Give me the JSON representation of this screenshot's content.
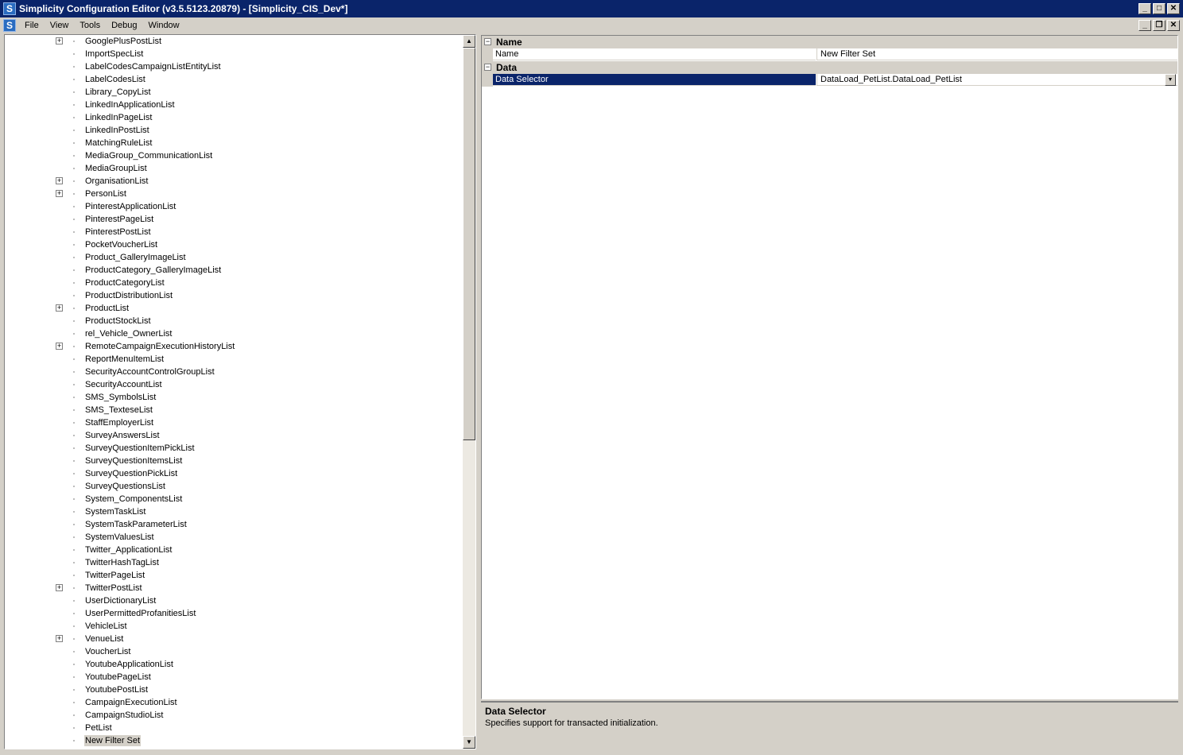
{
  "window": {
    "title": "Simplicity Configuration Editor (v3.5.5123.20879) - [Simplicity_CIS_Dev*]",
    "app_icon": "S",
    "controls": {
      "minimize": "_",
      "maximize": "□",
      "close": "✕"
    }
  },
  "menu": {
    "icon": "S",
    "items": [
      "File",
      "View",
      "Tools",
      "Debug",
      "Window"
    ],
    "mdi_controls": {
      "minimize": "_",
      "restore": "❐",
      "close": "✕"
    }
  },
  "tree": {
    "items": [
      {
        "label": "GooglePlusPostList",
        "expandable": true
      },
      {
        "label": "ImportSpecList",
        "expandable": false
      },
      {
        "label": "LabelCodesCampaignListEntityList",
        "expandable": false
      },
      {
        "label": "LabelCodesList",
        "expandable": false
      },
      {
        "label": "Library_CopyList",
        "expandable": false
      },
      {
        "label": "LinkedInApplicationList",
        "expandable": false
      },
      {
        "label": "LinkedInPageList",
        "expandable": false
      },
      {
        "label": "LinkedInPostList",
        "expandable": false
      },
      {
        "label": "MatchingRuleList",
        "expandable": false
      },
      {
        "label": "MediaGroup_CommunicationList",
        "expandable": false
      },
      {
        "label": "MediaGroupList",
        "expandable": false
      },
      {
        "label": "OrganisationList",
        "expandable": true
      },
      {
        "label": "PersonList",
        "expandable": true
      },
      {
        "label": "PinterestApplicationList",
        "expandable": false
      },
      {
        "label": "PinterestPageList",
        "expandable": false
      },
      {
        "label": "PinterestPostList",
        "expandable": false
      },
      {
        "label": "PocketVoucherList",
        "expandable": false
      },
      {
        "label": "Product_GalleryImageList",
        "expandable": false
      },
      {
        "label": "ProductCategory_GalleryImageList",
        "expandable": false
      },
      {
        "label": "ProductCategoryList",
        "expandable": false
      },
      {
        "label": "ProductDistributionList",
        "expandable": false
      },
      {
        "label": "ProductList",
        "expandable": true
      },
      {
        "label": "ProductStockList",
        "expandable": false
      },
      {
        "label": "rel_Vehicle_OwnerList",
        "expandable": false
      },
      {
        "label": "RemoteCampaignExecutionHistoryList",
        "expandable": true
      },
      {
        "label": "ReportMenuItemList",
        "expandable": false
      },
      {
        "label": "SecurityAccountControlGroupList",
        "expandable": false
      },
      {
        "label": "SecurityAccountList",
        "expandable": false
      },
      {
        "label": "SMS_SymbolsList",
        "expandable": false
      },
      {
        "label": "SMS_TexteseList",
        "expandable": false
      },
      {
        "label": "StaffEmployerList",
        "expandable": false
      },
      {
        "label": "SurveyAnswersList",
        "expandable": false
      },
      {
        "label": "SurveyQuestionItemPickList",
        "expandable": false
      },
      {
        "label": "SurveyQuestionItemsList",
        "expandable": false
      },
      {
        "label": "SurveyQuestionPickList",
        "expandable": false
      },
      {
        "label": "SurveyQuestionsList",
        "expandable": false
      },
      {
        "label": "System_ComponentsList",
        "expandable": false
      },
      {
        "label": "SystemTaskList",
        "expandable": false
      },
      {
        "label": "SystemTaskParameterList",
        "expandable": false
      },
      {
        "label": "SystemValuesList",
        "expandable": false
      },
      {
        "label": "Twitter_ApplicationList",
        "expandable": false
      },
      {
        "label": "TwitterHashTagList",
        "expandable": false
      },
      {
        "label": "TwitterPageList",
        "expandable": false
      },
      {
        "label": "TwitterPostList",
        "expandable": true
      },
      {
        "label": "UserDictionaryList",
        "expandable": false
      },
      {
        "label": "UserPermittedProfanitiesList",
        "expandable": false
      },
      {
        "label": "VehicleList",
        "expandable": false
      },
      {
        "label": "VenueList",
        "expandable": true
      },
      {
        "label": "VoucherList",
        "expandable": false
      },
      {
        "label": "YoutubeApplicationList",
        "expandable": false
      },
      {
        "label": "YoutubePageList",
        "expandable": false
      },
      {
        "label": "YoutubePostList",
        "expandable": false
      },
      {
        "label": "CampaignExecutionList",
        "expandable": false
      },
      {
        "label": "CampaignStudioList",
        "expandable": false
      },
      {
        "label": "PetList",
        "expandable": false
      },
      {
        "label": "New Filter Set",
        "expandable": false,
        "selected": true
      }
    ],
    "expander_glyph": "+"
  },
  "scrollbar": {
    "up_glyph": "▲",
    "down_glyph": "▼"
  },
  "property_grid": {
    "categories": [
      {
        "label": "Name",
        "collapse_glyph": "−",
        "properties": [
          {
            "name": "Name",
            "value": "New Filter Set",
            "selected": false
          }
        ]
      },
      {
        "label": "Data",
        "collapse_glyph": "−",
        "properties": [
          {
            "name": "Data Selector",
            "value": "DataLoad_PetList.DataLoad_PetList",
            "selected": true,
            "dropdown": true
          }
        ]
      }
    ],
    "dropdown_glyph": "▼"
  },
  "help": {
    "title": "Data Selector",
    "description": "Specifies support for transacted initialization."
  },
  "colors": {
    "titlebar": "#0a246a",
    "selection": "#0a246a",
    "chrome": "#d4d0c8"
  }
}
